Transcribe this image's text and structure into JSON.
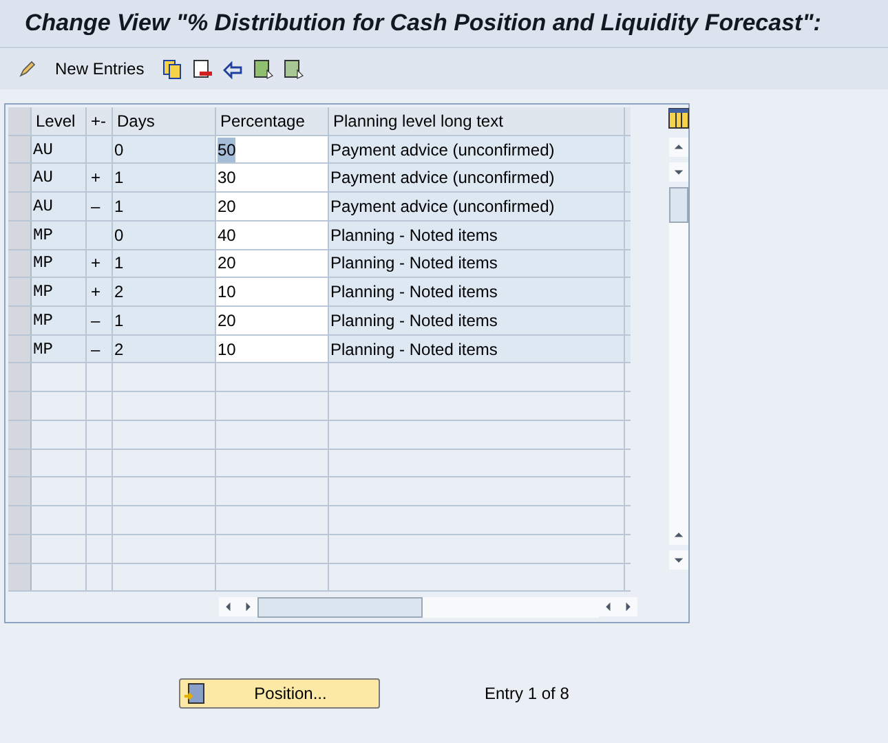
{
  "window": {
    "title": "Change View \"% Distribution for Cash Position and Liquidity Forecast\":"
  },
  "toolbar": {
    "new_entries": "New Entries"
  },
  "table": {
    "columns": [
      "Level",
      "+-",
      "Days",
      "Percentage",
      "Planning level long text"
    ],
    "rows": [
      {
        "level": "AU",
        "sign": "",
        "days": "0",
        "percentage": "50",
        "text": "Payment advice (unconfirmed)",
        "highlighted": true
      },
      {
        "level": "AU",
        "sign": "+",
        "days": "1",
        "percentage": "30",
        "text": "Payment advice (unconfirmed)",
        "highlighted": false
      },
      {
        "level": "AU",
        "sign": "–",
        "days": "1",
        "percentage": "20",
        "text": "Payment advice (unconfirmed)",
        "highlighted": false
      },
      {
        "level": "MP",
        "sign": "",
        "days": "0",
        "percentage": "40",
        "text": "Planning - Noted items",
        "highlighted": false
      },
      {
        "level": "MP",
        "sign": "+",
        "days": "1",
        "percentage": "20",
        "text": "Planning - Noted items",
        "highlighted": false
      },
      {
        "level": "MP",
        "sign": "+",
        "days": "2",
        "percentage": "10",
        "text": "Planning - Noted items",
        "highlighted": false
      },
      {
        "level": "MP",
        "sign": "–",
        "days": "1",
        "percentage": "20",
        "text": "Planning - Noted items",
        "highlighted": false
      },
      {
        "level": "MP",
        "sign": "–",
        "days": "2",
        "percentage": "10",
        "text": "Planning - Noted items",
        "highlighted": false
      }
    ]
  },
  "footer": {
    "position_button": "Position...",
    "entry_info": "Entry 1 of 8"
  }
}
